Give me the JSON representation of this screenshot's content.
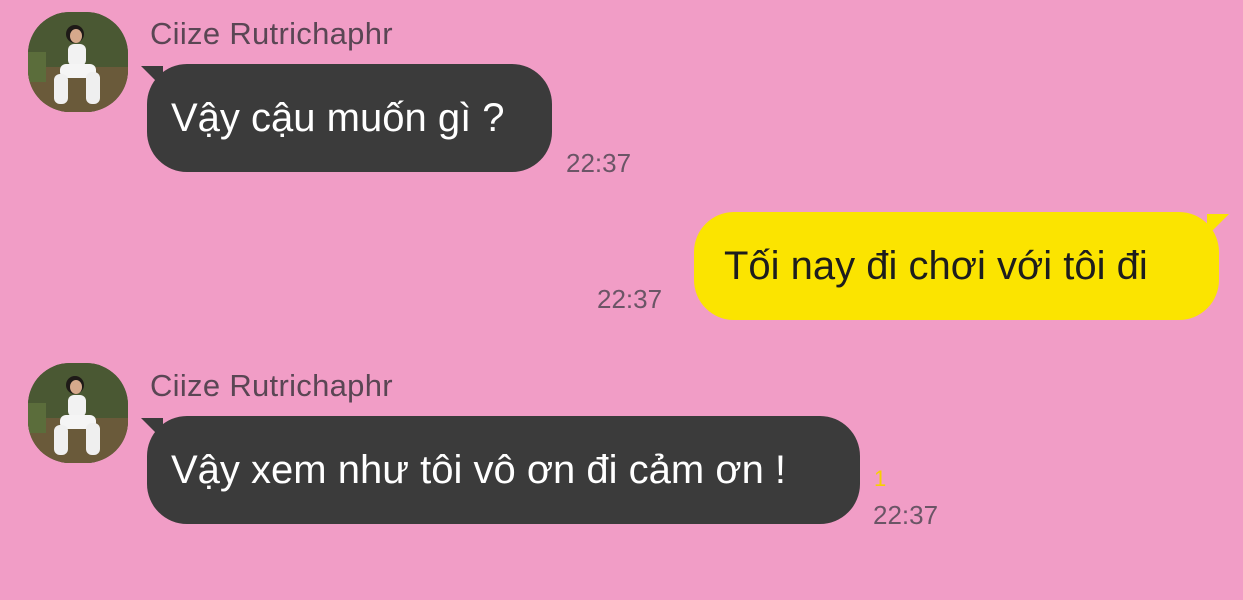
{
  "messages": [
    {
      "sender": "Ciize Rutrichaphr",
      "text": "Vậy cậu muốn gì ?",
      "time": "22:37",
      "direction": "incoming"
    },
    {
      "text": "Tối nay đi chơi với tôi đi",
      "time": "22:37",
      "direction": "outgoing"
    },
    {
      "sender": "Ciize Rutrichaphr",
      "text": "Vậy xem như tôi vô ơn đi cảm ơn !",
      "time": "22:37",
      "unread_count": "1",
      "direction": "incoming"
    }
  ],
  "colors": {
    "background": "#f19dc6",
    "incoming_bubble": "#3b3b3b",
    "outgoing_bubble": "#fbe400",
    "unread": "#f7d000"
  },
  "icons": [
    "avatar-photo"
  ]
}
